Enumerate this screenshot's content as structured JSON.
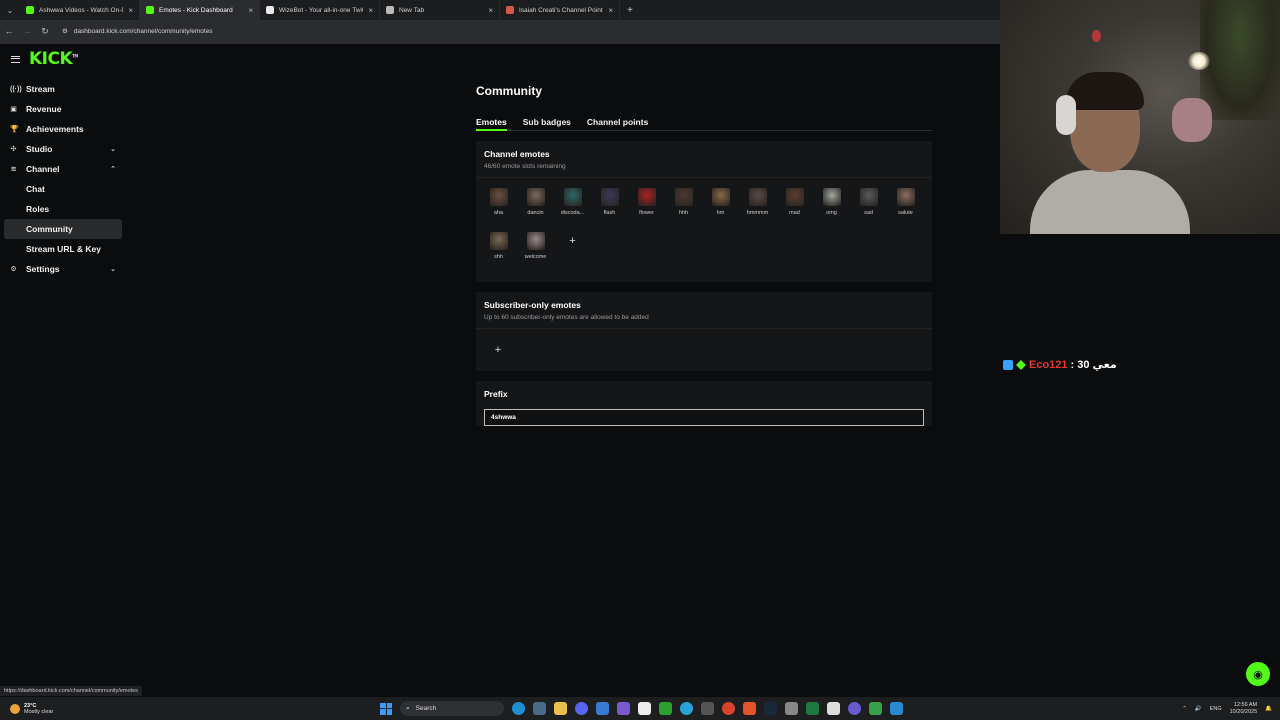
{
  "browser": {
    "tabs": [
      {
        "title": "Ashwwa Videos - Watch On-De",
        "color": "#53fc18",
        "active": false
      },
      {
        "title": "Emotes - Kick Dashboard",
        "color": "#53fc18",
        "active": true
      },
      {
        "title": "WizeBot - Your all-in-one Twitc",
        "color": "#e8e8e8",
        "active": false
      },
      {
        "title": "New Tab",
        "color": "#bbbbbb",
        "active": false
      },
      {
        "title": "Isaiah Creati's Channel Point Bo",
        "color": "#d6584a",
        "active": false
      }
    ],
    "url": "dashboard.kick.com/channel/community/emotes",
    "status_url": "https://dashboard.kick.com/channel/community/emotes"
  },
  "brand": {
    "logo": "KICK",
    "tm": "TM",
    "accent": "#53fc18"
  },
  "sidebar": {
    "items": [
      {
        "label": "Stream",
        "icon": "broadcast-icon",
        "glyph": "((·))"
      },
      {
        "label": "Revenue",
        "icon": "revenue-icon",
        "glyph": "▣"
      },
      {
        "label": "Achievements",
        "icon": "trophy-icon",
        "glyph": "🏆"
      },
      {
        "label": "Studio",
        "icon": "studio-icon",
        "glyph": "✣",
        "chevron": "⌄"
      },
      {
        "label": "Channel",
        "icon": "channel-icon",
        "glyph": "≋",
        "chevron": "⌃"
      }
    ],
    "sub_items": [
      "Chat",
      "Roles",
      "Community",
      "Stream URL & Key"
    ],
    "settings": {
      "label": "Settings",
      "icon": "gear-icon",
      "glyph": "⚙",
      "chevron": "⌄"
    }
  },
  "main": {
    "title": "Community",
    "tabs": [
      "Emotes",
      "Sub badges",
      "Channel points"
    ],
    "channel_emotes": {
      "heading": "Channel emotes",
      "subtext": "46/60 emote slots remaining",
      "emotes": [
        {
          "name": "aha",
          "color": "#6b5040"
        },
        {
          "name": "dancin",
          "color": "#7a6a5c"
        },
        {
          "name": "discoda...",
          "color": "#2a6a6a"
        },
        {
          "name": "flash",
          "color": "#3a3a5a"
        },
        {
          "name": "flower",
          "color": "#b02020"
        },
        {
          "name": "hhh",
          "color": "#4a3a30"
        },
        {
          "name": "hm",
          "color": "#8a6a4a"
        },
        {
          "name": "hmmmm",
          "color": "#5a4a44"
        },
        {
          "name": "mad",
          "color": "#5a4030"
        },
        {
          "name": "omg",
          "color": "#a0a8a0"
        },
        {
          "name": "sad",
          "color": "#5a5a5e"
        },
        {
          "name": "salute",
          "color": "#8a7060"
        },
        {
          "name": "shh",
          "color": "#7a6a58"
        },
        {
          "name": "welcome",
          "color": "#9a8a8a"
        }
      ],
      "add": "+"
    },
    "subscriber_emotes": {
      "heading": "Subscriber-only emotes",
      "subtext": "Up to 60 subscriber-only emotes are allowed to be added",
      "add": "+"
    },
    "prefix": {
      "heading": "Prefix",
      "value": "4shwwa"
    }
  },
  "overlay": {
    "message": "30 معي",
    "separator": ":",
    "user": "Eco121"
  },
  "taskbar": {
    "temp": "23°C",
    "weather": "Mostly clear",
    "search": "Search",
    "lang": "ENG",
    "time": "12:56 AM",
    "date": "10/20/2025"
  }
}
